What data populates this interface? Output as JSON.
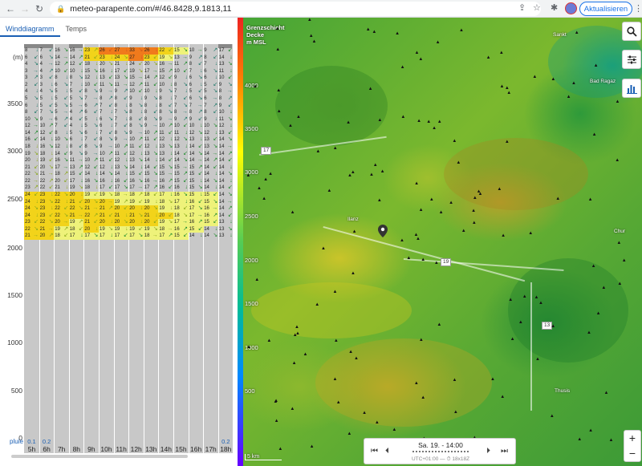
{
  "browser": {
    "url": "meteo-parapente.com/#/46.8428,9.1813,11",
    "update_label": "Aktualisieren"
  },
  "tabs": [
    {
      "label": "Winddiagramm",
      "active": true
    },
    {
      "label": "Temps",
      "active": false
    }
  ],
  "diagram": {
    "unit": "(m)",
    "y_ticks": [
      "3500",
      "3000",
      "2500",
      "2000",
      "1500",
      "1000",
      "500",
      "0"
    ],
    "hours": [
      "5h",
      "6h",
      "7h",
      "8h",
      "9h",
      "10h",
      "11h",
      "12h",
      "13h",
      "14h",
      "15h",
      "16h",
      "17h",
      "18h"
    ],
    "rain_label": "pluie",
    "rain_values": [
      "0.1",
      "0.2",
      "",
      "",
      "",
      "",
      "",
      "",
      "",
      "",
      "",
      "",
      "",
      "0.2"
    ],
    "wind_speeds": [
      [
        8,
        7,
        16,
        16,
        23,
        26,
        27,
        33,
        26,
        22,
        15,
        10,
        9,
        17
      ],
      [
        6,
        6,
        14,
        14,
        21,
        23,
        24,
        27,
        23,
        19,
        13,
        9,
        8,
        14
      ],
      [
        4,
        4,
        12,
        12,
        18,
        20,
        21,
        24,
        20,
        16,
        11,
        8,
        7,
        13
      ],
      [
        3,
        4,
        10,
        10,
        15,
        16,
        17,
        19,
        17,
        15,
        10,
        7,
        6,
        11
      ],
      [
        3,
        3,
        8,
        8,
        12,
        13,
        13,
        15,
        14,
        12,
        9,
        6,
        6,
        10
      ],
      [
        2,
        3,
        6,
        7,
        10,
        11,
        11,
        12,
        11,
        10,
        8,
        6,
        5,
        9
      ],
      [
        4,
        4,
        5,
        5,
        8,
        9,
        9,
        10,
        10,
        9,
        7,
        5,
        5,
        8
      ],
      [
        5,
        5,
        5,
        5,
        7,
        8,
        8,
        9,
        9,
        8,
        7,
        6,
        6,
        8
      ],
      [
        6,
        5,
        5,
        5,
        6,
        7,
        8,
        8,
        8,
        8,
        7,
        7,
        7,
        9
      ],
      [
        8,
        7,
        5,
        4,
        6,
        7,
        7,
        8,
        8,
        8,
        8,
        8,
        8,
        10
      ],
      [
        10,
        9,
        6,
        4,
        5,
        6,
        7,
        8,
        8,
        9,
        9,
        9,
        9,
        11
      ],
      [
        12,
        10,
        7,
        4,
        5,
        6,
        7,
        8,
        9,
        10,
        10,
        10,
        10,
        12
      ],
      [
        14,
        12,
        8,
        5,
        6,
        7,
        8,
        9,
        10,
        11,
        11,
        12,
        12,
        13
      ],
      [
        16,
        14,
        10,
        6,
        7,
        8,
        9,
        10,
        11,
        12,
        12,
        13,
        13,
        14
      ],
      [
        18,
        16,
        12,
        8,
        8,
        9,
        10,
        11,
        12,
        13,
        13,
        14,
        13,
        14
      ],
      [
        19,
        18,
        14,
        9,
        9,
        10,
        11,
        12,
        13,
        13,
        14,
        14,
        14,
        14
      ],
      [
        20,
        19,
        16,
        11,
        10,
        11,
        12,
        13,
        14,
        14,
        14,
        14,
        14,
        14
      ],
      [
        21,
        20,
        17,
        13,
        12,
        12,
        13,
        14,
        14,
        15,
        15,
        15,
        14,
        14
      ],
      [
        22,
        21,
        18,
        15,
        14,
        14,
        14,
        15,
        15,
        15,
        15,
        15,
        14,
        14
      ],
      [
        22,
        22,
        20,
        17,
        16,
        16,
        16,
        16,
        16,
        16,
        15,
        15,
        14,
        14
      ],
      [
        23,
        22,
        21,
        19,
        18,
        17,
        17,
        17,
        17,
        16,
        16,
        15,
        14,
        14
      ],
      [
        24,
        23,
        22,
        20,
        19,
        19,
        18,
        18,
        18,
        17,
        16,
        15,
        15,
        14
      ],
      [
        24,
        23,
        22,
        21,
        20,
        20,
        19,
        19,
        19,
        18,
        17,
        16,
        15,
        14
      ],
      [
        24,
        23,
        22,
        22,
        21,
        21,
        20,
        20,
        20,
        19,
        18,
        17,
        16,
        14
      ],
      [
        24,
        23,
        22,
        21,
        22,
        21,
        21,
        21,
        21,
        20,
        18,
        17,
        16,
        14
      ],
      [
        23,
        22,
        20,
        19,
        21,
        20,
        20,
        20,
        20,
        19,
        17,
        16,
        15,
        13
      ],
      [
        22,
        21,
        19,
        18,
        20,
        19,
        19,
        19,
        19,
        18,
        16,
        15,
        14,
        13
      ],
      [
        21,
        20,
        18,
        17,
        17,
        17,
        17,
        17,
        18,
        17,
        15,
        14,
        14,
        13
      ]
    ]
  },
  "map": {
    "title_lines": [
      "Grenzschicht",
      "Decke",
      "m MSL"
    ],
    "y_ticks": [
      "4000",
      "3500",
      "3000",
      "2500",
      "2000",
      "1500",
      "1000",
      "500"
    ],
    "roads": [
      "17",
      "19",
      "13"
    ],
    "places": [
      "Sankt",
      "Bad Ragaz",
      "Chur",
      "Thusis",
      "Ilanz"
    ],
    "scale_label": "5 km",
    "time_label": "Sa. 19. - 14:00",
    "time_sub": "UTC+01:00 — ⏱ 18x18Z"
  }
}
